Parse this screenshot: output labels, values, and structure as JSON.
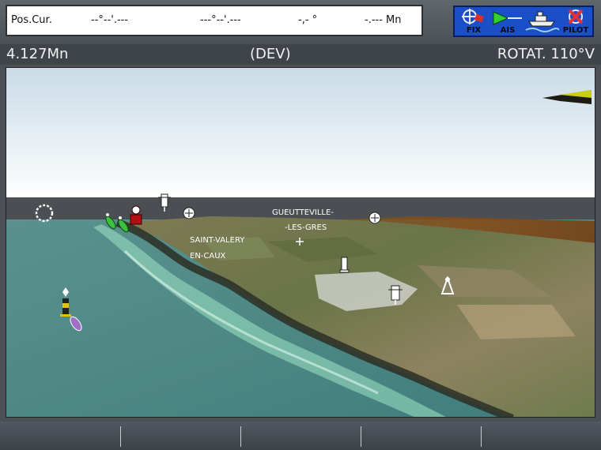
{
  "position_bar": {
    "label": "Pos.Cur.",
    "lat": "--°--'.---",
    "lon": "---°--'.---",
    "bearing": "-,- °",
    "distance": "-.--- Mn"
  },
  "toolbar": {
    "fix_label": "FIX",
    "ais_label": "AIS",
    "pilot_label": "PILOT"
  },
  "info_bar": {
    "range": "4.127Mn",
    "mode": "(DEV)",
    "rotation": "ROTAT. 110°V"
  },
  "chart_view": {
    "place_labels": {
      "gueutteville_1": "GUEUTTEVILLE-",
      "gueutteville_2": "-LES-GRES",
      "saint_valery_1": "SAINT-VALERY",
      "saint_valery_2": "EN-CAUX"
    }
  },
  "softkeys": [
    "",
    "",
    "",
    "",
    ""
  ],
  "colors": {
    "toolbar_blue": "#1b4fc8",
    "sea": "#4f8c88",
    "sky": "#ffffff",
    "marker_green": "#3fbf3f",
    "marker_red": "#b01010",
    "marker_purple": "#a070c8"
  }
}
